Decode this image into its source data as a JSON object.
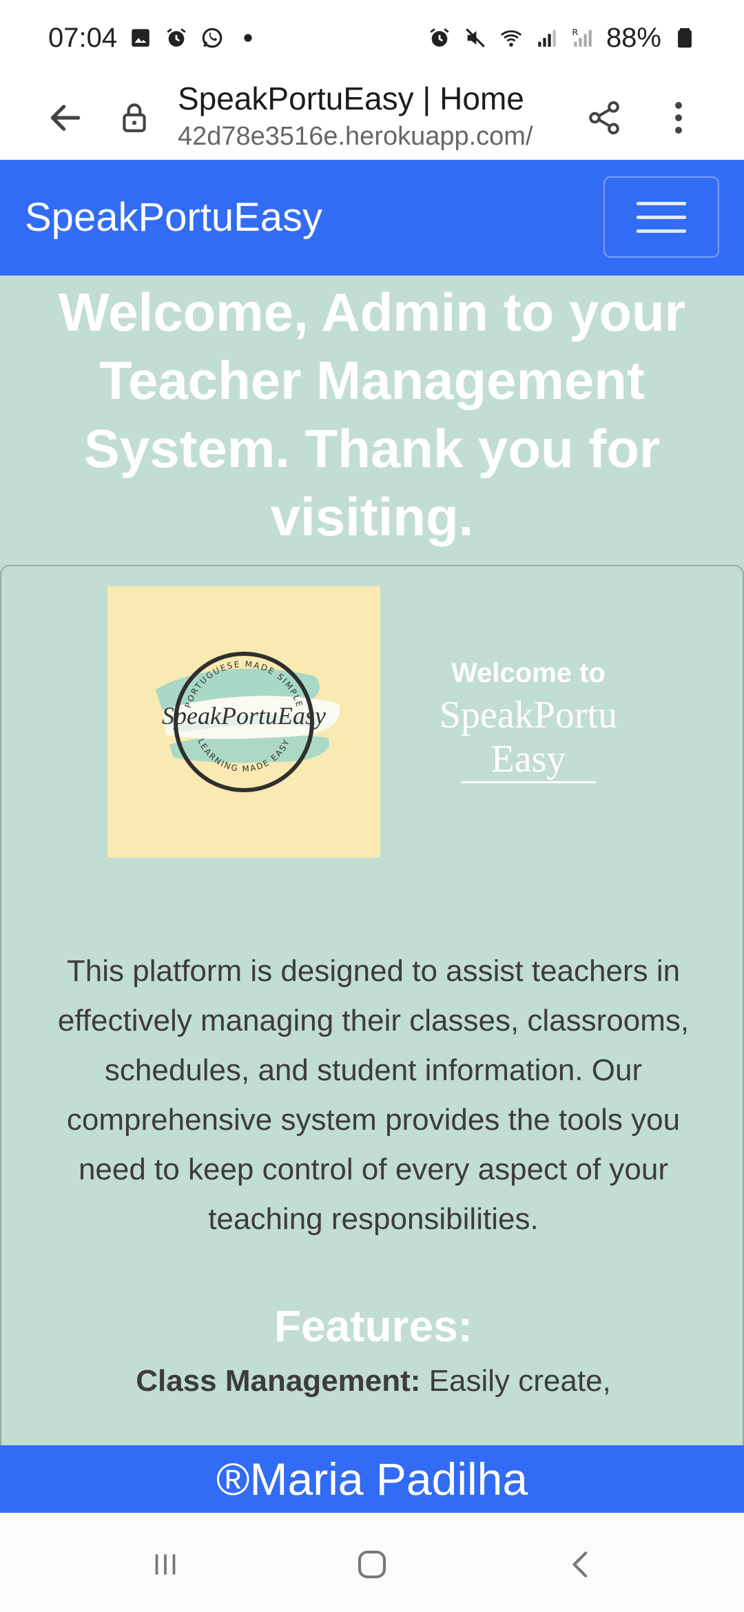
{
  "status_bar": {
    "time": "07:04",
    "left_icons": [
      "image-icon",
      "alarm-icon",
      "whatsapp-icon",
      "dot-icon"
    ],
    "right_icons": [
      "alarm-icon",
      "mute-icon",
      "wifi-icon",
      "signal-icon",
      "signal-r-icon"
    ],
    "battery": "88%"
  },
  "browser": {
    "title": "SpeakPortuEasy | Home",
    "url": "42d78e3516e.herokuapp.com/"
  },
  "navbar": {
    "brand": "SpeakPortuEasy",
    "color": "#326cf4"
  },
  "main": {
    "welcome": "Welcome, Admin to your Teacher Management System. Thank you for visiting.",
    "background": "#c2ddd1",
    "logo": {
      "circle_text_top": "PORTUGUESE MADE SIMPLE",
      "circle_text_bottom": "LEARNING MADE EASY",
      "script": "SpeakPortuEasy"
    },
    "side_welcome": {
      "top": "Welcome to",
      "brand_line1": "SpeakPortu",
      "brand_line2": "Easy"
    },
    "description": "This platform is designed to assist teachers in effectively managing their classes, classrooms, schedules, and student information. Our comprehensive system provides the tools you need to keep control of every aspect of your teaching responsibilities.",
    "features_title": "Features:",
    "features": [
      {
        "name": "Class Management:",
        "text": " Easily create,"
      }
    ]
  },
  "footer": {
    "text": "®Maria Padilha"
  }
}
